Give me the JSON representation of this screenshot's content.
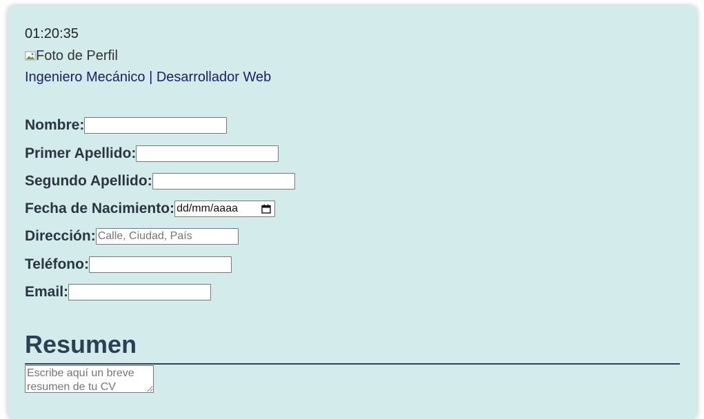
{
  "clock": {
    "time": "01:20:35"
  },
  "profile": {
    "photo_alt": "Foto de Perfil",
    "profession": "Ingeniero Mecánico | Desarrollador Web"
  },
  "form": {
    "nombre": {
      "label": "Nombre:",
      "value": "",
      "placeholder": ""
    },
    "primer_apellido": {
      "label": "Primer Apellido:",
      "value": "",
      "placeholder": ""
    },
    "segundo_apellido": {
      "label": "Segundo Apellido:",
      "value": "",
      "placeholder": ""
    },
    "fecha_nacimiento": {
      "label": "Fecha de Nacimiento:",
      "value": "dd/mm/aaaa"
    },
    "direccion": {
      "label": "Dirección:",
      "value": "",
      "placeholder": "Calle, Ciudad, País"
    },
    "telefono": {
      "label": "Teléfono:",
      "value": "",
      "placeholder": ""
    },
    "email": {
      "label": "Email:",
      "value": "",
      "placeholder": ""
    }
  },
  "resumen": {
    "title": "Resumen",
    "placeholder": "Escribe aquí un breve resumen de tu CV",
    "value": ""
  },
  "colors": {
    "card_background": "#d4ebec",
    "label_text": "#2b3540",
    "profession_text": "#1c1c6b",
    "section_title": "#2b3f55"
  },
  "icons": {
    "photo": "broken-image-icon",
    "date": "calendar-icon"
  }
}
